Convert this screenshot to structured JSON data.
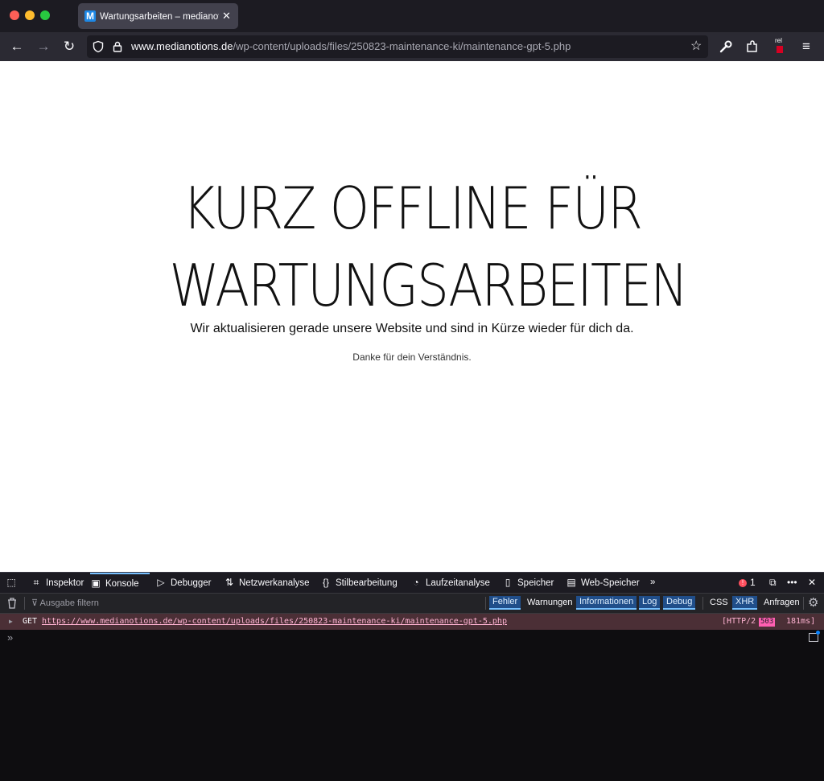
{
  "browser": {
    "tab_title": "Wartungsarbeiten – medianotions",
    "favicon_letter": "M",
    "url_domain": "www.medianotions.de",
    "url_path": "/wp-content/uploads/files/250823-maintenance-ki/maintenance-gpt-5.php",
    "extension_badge": "rel"
  },
  "page": {
    "headline_line1": "KURZ OFFLINE FÜR",
    "headline_line2": "WARTUNGSARBEITEN",
    "lead": "Wir aktualisieren gerade unsere Website und sind in Kürze wieder für dich da.",
    "note": "Danke für dein Verständnis."
  },
  "devtools": {
    "tabs": [
      "Inspektor",
      "Konsole",
      "Debugger",
      "Netzwerkanalyse",
      "Stilbearbeitung",
      "Laufzeitanalyse",
      "Speicher",
      "Web-Speicher"
    ],
    "error_count": "1",
    "filter_placeholder": "Ausgabe filtern",
    "filters": [
      "Fehler",
      "Warnungen",
      "Informationen",
      "Log",
      "Debug"
    ],
    "extra_filters": [
      "CSS",
      "XHR",
      "Anfragen"
    ],
    "message": {
      "method": "GET",
      "url": "https://www.medianotions.de/wp-content/uploads/files/250823-maintenance-ki/maintenance-gpt-5.php",
      "protocol": "[HTTP/2",
      "status": "503",
      "time": "181ms]"
    }
  }
}
